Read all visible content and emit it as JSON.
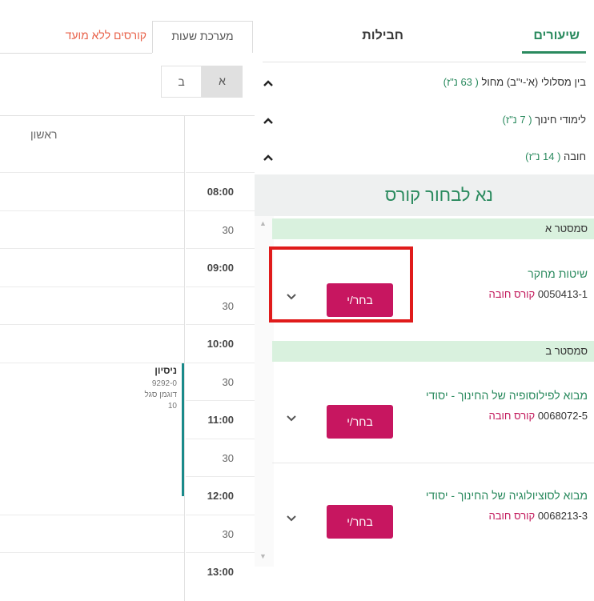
{
  "tabs": {
    "lessons": "שיעורים",
    "packages": "חבילות"
  },
  "filters": [
    {
      "label": "בין מסלולי (א'-י\"ב) מחול",
      "credits": "( 63 נ\"ז)"
    },
    {
      "label": "לימודי חינוך",
      "credits": "( 7 נ\"ז)"
    },
    {
      "label": "חובה",
      "credits": "( 14 נ\"ז)"
    }
  ],
  "choose_title": "נא לבחור קורס",
  "semesters": [
    {
      "label": "סמסטר א"
    },
    {
      "label": "סמסטר ב"
    }
  ],
  "courses": [
    {
      "name": "שיטות מחקר",
      "code": "0050413-1",
      "type": "קורס חובה",
      "button": "בחר/י"
    },
    {
      "name": "מבוא לפילוסופיה של החינוך - יסודי",
      "code": "0068072-5",
      "type": "קורס חובה",
      "button": "בחר/י"
    },
    {
      "name": "מבוא לסוציולוגיה של החינוך - יסודי",
      "code": "0068213-3",
      "type": "קורס חובה",
      "button": "בחר/י"
    }
  ],
  "schedule_tabs": {
    "schedule": "מערכת שעות",
    "no_date": "קורסים ללא מועד"
  },
  "week_toggle": {
    "a": "א",
    "b": "ב"
  },
  "day_header": "ראשון",
  "times": [
    "08:00",
    "30",
    "09:00",
    "30",
    "10:00",
    "30",
    "11:00",
    "30",
    "12:00",
    "30",
    "13:00"
  ],
  "event": {
    "title": "ניסיון",
    "code": "9292-0",
    "lecturer": "דוגמן סגל",
    "room": "10"
  },
  "colors": {
    "accent": "#2a8a5e",
    "button": "#c71660",
    "highlight": "#e01b1b",
    "semester_bg": "#d9f1de"
  }
}
